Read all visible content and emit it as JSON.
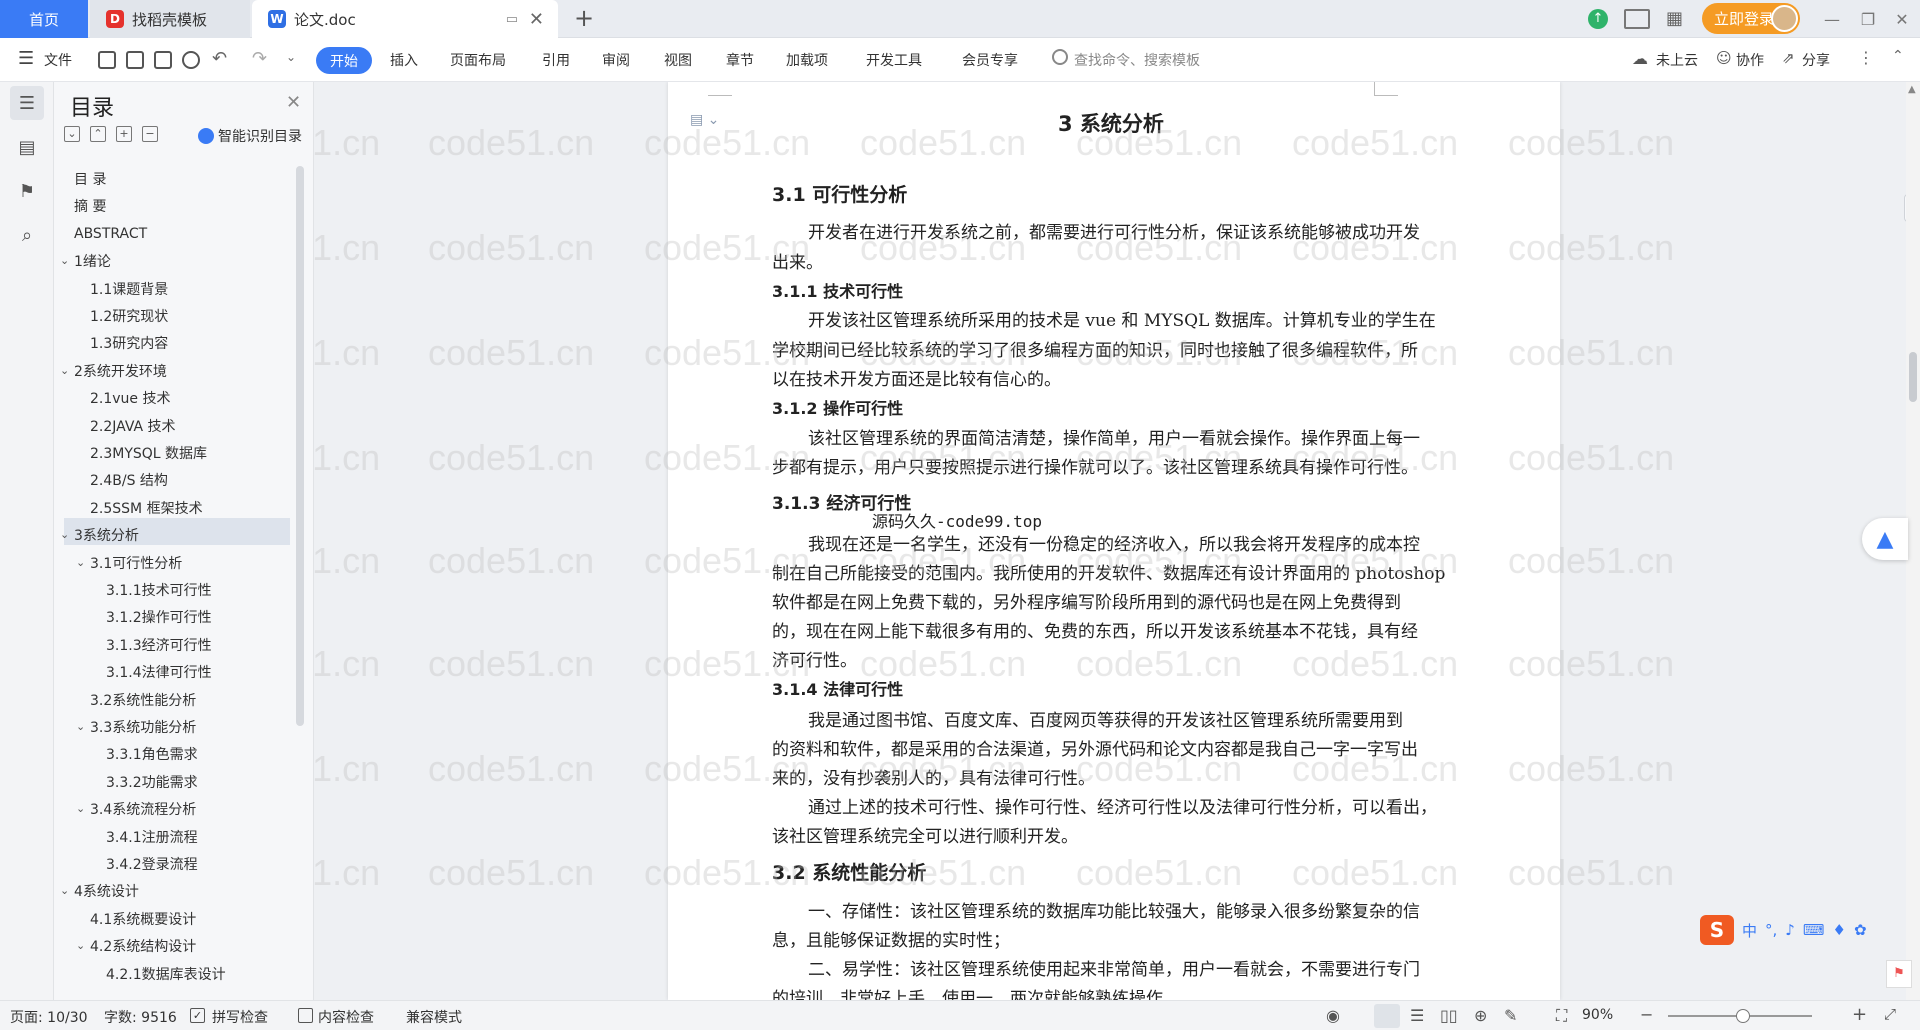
{
  "tabs": {
    "home": "首页",
    "template": "找稻壳模板",
    "doc": "论文.doc"
  },
  "window": {
    "login_label": "立即登录"
  },
  "toolbar": {
    "file": "文件",
    "start": "开始",
    "insert": "插入",
    "layout": "页面布局",
    "reference": "引用",
    "review": "审阅",
    "view": "视图",
    "chapter": "章节",
    "addons": "加载项",
    "devtools": "开发工具",
    "member": "会员专享",
    "search_placeholder": "查找命令、搜索模板",
    "cloud": "未上云",
    "collab": "协作",
    "share": "分享"
  },
  "toc": {
    "title": "目录",
    "ai_label": "智能识别目录",
    "items": [
      {
        "label": "目  录",
        "level": 0,
        "caret": ""
      },
      {
        "label": "摘    要",
        "level": 0,
        "caret": ""
      },
      {
        "label": "ABSTRACT",
        "level": 0,
        "caret": ""
      },
      {
        "label": "1绪论",
        "level": 0,
        "caret": "v"
      },
      {
        "label": "1.1课题背景",
        "level": 1,
        "caret": ""
      },
      {
        "label": "1.2研究现状",
        "level": 1,
        "caret": ""
      },
      {
        "label": "1.3研究内容",
        "level": 1,
        "caret": ""
      },
      {
        "label": "2系统开发环境",
        "level": 0,
        "caret": "v"
      },
      {
        "label": "2.1vue 技术",
        "level": 1,
        "caret": ""
      },
      {
        "label": "2.2JAVA 技术",
        "level": 1,
        "caret": ""
      },
      {
        "label": "2.3MYSQL 数据库",
        "level": 1,
        "caret": ""
      },
      {
        "label": "2.4B/S 结构",
        "level": 1,
        "caret": ""
      },
      {
        "label": "2.5SSM 框架技术",
        "level": 1,
        "caret": ""
      },
      {
        "label": "3系统分析",
        "level": 0,
        "caret": "v"
      },
      {
        "label": "3.1可行性分析",
        "level": 1,
        "caret": "v"
      },
      {
        "label": "3.1.1技术可行性",
        "level": 2,
        "caret": ""
      },
      {
        "label": "3.1.2操作可行性",
        "level": 2,
        "caret": ""
      },
      {
        "label": "3.1.3经济可行性",
        "level": 2,
        "caret": ""
      },
      {
        "label": "3.1.4法律可行性",
        "level": 2,
        "caret": ""
      },
      {
        "label": "3.2系统性能分析",
        "level": 1,
        "caret": ""
      },
      {
        "label": "3.3系统功能分析",
        "level": 1,
        "caret": "v"
      },
      {
        "label": "3.3.1角色需求",
        "level": 2,
        "caret": ""
      },
      {
        "label": "3.3.2功能需求",
        "level": 2,
        "caret": ""
      },
      {
        "label": "3.4系统流程分析",
        "level": 1,
        "caret": "v"
      },
      {
        "label": "3.4.1注册流程",
        "level": 2,
        "caret": ""
      },
      {
        "label": "3.4.2登录流程",
        "level": 2,
        "caret": ""
      },
      {
        "label": "4系统设计",
        "level": 0,
        "caret": "v"
      },
      {
        "label": "4.1系统概要设计",
        "level": 1,
        "caret": ""
      },
      {
        "label": "4.2系统结构设计",
        "level": 1,
        "caret": "v"
      },
      {
        "label": "4.2.1数据库表设计",
        "level": 2,
        "caret": ""
      }
    ]
  },
  "document": {
    "chapter_title": "3  系统分析",
    "s31": "3.1  可行性分析",
    "p31": [
      "开发者在进行开发系统之前，都需要进行可行性分析，保证该系统能够被成功开发",
      "出来。"
    ],
    "s311": "3.1.1  技术可行性",
    "p311": [
      "开发该社区管理系统所采用的技术是 vue 和 MYSQL 数据库。计算机专业的学生在",
      "学校期间已经比较系统的学习了很多编程方面的知识，同时也接触了很多编程软件，所",
      "以在技术开发方面还是比较有信心的。"
    ],
    "s312": "3.1.2  操作可行性",
    "p312": [
      "该社区管理系统的界面简洁清楚，操作简单，用户一看就会操作。操作界面上每一",
      "步都有提示，用户只要按照提示进行操作就可以了。该社区管理系统具有操作可行性。"
    ],
    "s313": "3.1.3  经济可行性",
    "overlay": "源码久久-code99.top",
    "p313": [
      "我现在还是一名学生，还没有一份稳定的经济收入，所以我会将开发程序的成本控",
      "制在自己所能接受的范围内。我所使用的开发软件、数据库还有设计界面用的 photoshop",
      "软件都是在网上免费下载的，另外程序编写阶段所用到的源代码也是在网上免费得到",
      "的，现在在网上能下载很多有用的、免费的东西，所以开发该系统基本不花钱，具有经",
      "济可行性。"
    ],
    "s314": "3.1.4  法律可行性",
    "p314": [
      " 我是通过图书馆、百度文库、百度网页等获得的开发该社区管理系统所需要用到",
      "的资料和软件，都是采用的合法渠道，另外源代码和论文内容都是我自己一字一字写出",
      "来的，没有抄袭别人的，具有法律可行性。"
    ],
    "p315": [
      "通过上述的技术可行性、操作可行性、经济可行性以及法律可行性分析，可以看出，",
      "该社区管理系统完全可以进行顺利开发。"
    ],
    "s32": "3.2  系统性能分析",
    "p32": [
      "一、存储性：该社区管理系统的数据库功能比较强大，能够录入很多纷繁复杂的信",
      "息，且能够保证数据的实时性；",
      "二、易学性：该社区管理系统使用起来非常简单，用户一看就会，不需要进行专门",
      "的培训，非常好上手，使用一、两次就能够熟练操作。"
    ]
  },
  "watermark": "code51.cn",
  "status": {
    "page": "页面: 10/30",
    "words": "字数: 9516",
    "spell": "拼写检查",
    "content_check": "内容检查",
    "compat": "兼容模式",
    "zoom": "90%"
  },
  "ime": {
    "lang": "中"
  },
  "colors": {
    "accent": "#3a7bf5",
    "login": "#f59b24"
  }
}
